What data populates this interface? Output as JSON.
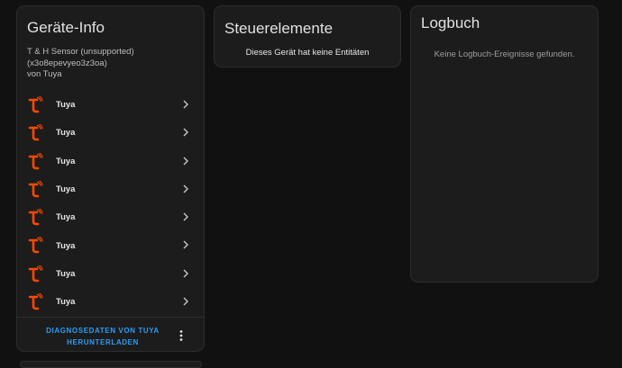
{
  "device_info": {
    "title": "Geräte-Info",
    "model": "T & H Sensor (unsupported)",
    "id": "(x3o8epevyeo3z3oa)",
    "manufacturer": "von Tuya",
    "entries": [
      {
        "label": "Tuya",
        "icon": "tuya-logo-icon"
      },
      {
        "label": "Tuya",
        "icon": "tuya-logo-icon"
      },
      {
        "label": "Tuya",
        "icon": "tuya-logo-icon"
      },
      {
        "label": "Tuya",
        "icon": "tuya-logo-icon"
      },
      {
        "label": "Tuya",
        "icon": "tuya-logo-icon"
      },
      {
        "label": "Tuya",
        "icon": "tuya-logo-icon"
      },
      {
        "label": "Tuya",
        "icon": "tuya-logo-icon"
      },
      {
        "label": "Tuya",
        "icon": "tuya-logo-icon"
      }
    ],
    "diagnostics_line1": "DIAGNOSEDATEN VON TUYA",
    "diagnostics_line2": "HERUNTERLADEN"
  },
  "controls": {
    "title": "Steuerelemente",
    "empty_message": "Dieses Gerät hat keine Entitäten"
  },
  "logbook": {
    "title": "Logbuch",
    "empty_message": "Keine Logbuch-Ereignisse gefunden."
  },
  "colors": {
    "background": "#111111",
    "card": "#1c1c1c",
    "accent": "#2a9ef5",
    "tuya_orange": "#ff4800"
  }
}
